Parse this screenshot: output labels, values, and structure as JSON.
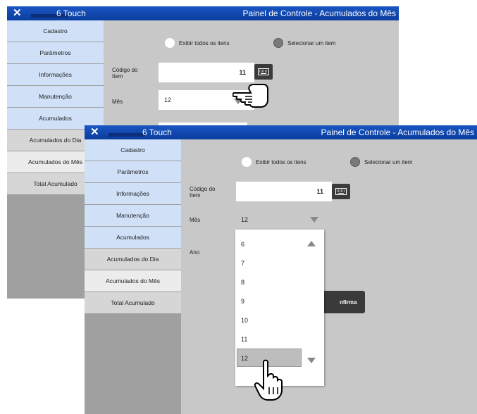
{
  "back_window": {
    "brand": "6 Touch",
    "title": "Painel de Controle - Acumulados do Mês",
    "sidebar": [
      "Cadastro",
      "Parâmetros",
      "Informações",
      "Manutenção",
      "Acumulados",
      "Acumulados do Dia",
      "Acumulados do Mês",
      "Total Acumulado"
    ],
    "radio_all": "Exibir todos os itens",
    "radio_select": "Selecionar um item",
    "codigo_label": "Código do Item",
    "codigo_value": "11",
    "mes_label": "Mês",
    "mes_value": "12"
  },
  "front_window": {
    "brand": "6 Touch",
    "title": "Painel de Controle - Acumulados do Mês",
    "sidebar": [
      "Cadastro",
      "Parâmetros",
      "Informações",
      "Manutenção",
      "Acumulados",
      "Acumulados do Dia",
      "Acumulados do Mês",
      "Total Acumulado"
    ],
    "radio_all": "Exibir todos os itens",
    "radio_select": "Selecionar um item",
    "codigo_label": "Código do Item",
    "codigo_value": "11",
    "mes_label": "Mês",
    "mes_value": "12",
    "ano_label": "Ano",
    "month_options": [
      "6",
      "7",
      "8",
      "9",
      "10",
      "11",
      "12"
    ],
    "selected_month": "12",
    "confirm_label": "nfirma"
  },
  "icons": {
    "close": "close-icon",
    "keyboard": "keyboard-icon",
    "dropdown": "chevron-down-icon",
    "scroll_up": "scroll-up-icon",
    "scroll_down": "scroll-down-icon",
    "pointer": "hand-pointer-icon"
  },
  "colors": {
    "titlebar": "#0a3d9e",
    "sidebar_blue": "#cfe0f7",
    "panel": "#c8c8c8"
  }
}
